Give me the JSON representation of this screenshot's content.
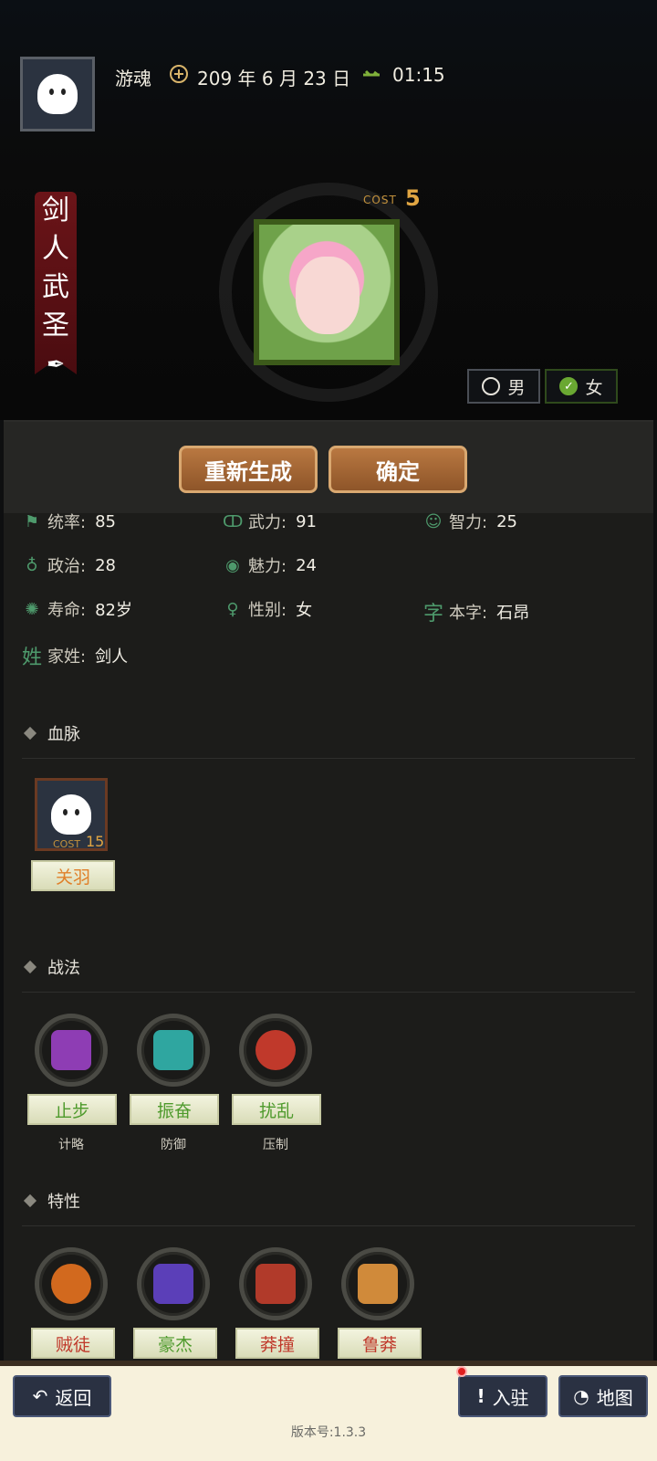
{
  "header": {
    "username": "游魂",
    "date": "209 年 6 月 23 日",
    "time": "01:15"
  },
  "character": {
    "title_chars": [
      "剑",
      "人",
      "武",
      "圣"
    ],
    "cost_label": "COST",
    "cost_value": "5",
    "gender_options": [
      {
        "label": "男",
        "selected": false
      },
      {
        "label": "女",
        "selected": true
      }
    ]
  },
  "actions": {
    "regenerate": "重新生成",
    "confirm": "确定"
  },
  "stats": [
    {
      "icon": "flag-icon",
      "label": "统率:",
      "value": "85"
    },
    {
      "icon": "muscle-icon",
      "label": "武力:",
      "value": "91"
    },
    {
      "icon": "brain-icon",
      "label": "智力:",
      "value": "25"
    },
    {
      "icon": "scroll-icon",
      "label": "政治:",
      "value": "28"
    },
    {
      "icon": "eye-icon",
      "label": "魅力:",
      "value": "24"
    },
    {
      "icon": "lifespan-icon",
      "label": "寿命:",
      "value": "82岁"
    },
    {
      "icon": "gender-icon",
      "label": "性别:",
      "value": "女"
    },
    {
      "icon": "zi-icon",
      "label": "本字:",
      "value": "石昂"
    },
    {
      "icon": "xing-icon",
      "label": "家姓:",
      "value": "剑人"
    }
  ],
  "icon_glyphs": {
    "zi": "字",
    "xing": "姓"
  },
  "sections": {
    "bloodline": "血脉",
    "tactics": "战法",
    "traits": "特性"
  },
  "bloodline": {
    "name": "关羽",
    "cost_label": "COST",
    "cost_value": "15"
  },
  "tactics": [
    {
      "name": "止步",
      "type": "计略",
      "color": "#8e3db4"
    },
    {
      "name": "振奋",
      "type": "防御",
      "color": "#2fa6a0"
    },
    {
      "name": "扰乱",
      "type": "压制",
      "color": "#c0392b"
    }
  ],
  "traits": [
    {
      "name": "贼徒",
      "color": "#d2691e",
      "text_color": "#c0392b"
    },
    {
      "name": "豪杰",
      "color": "#5b3fb8",
      "text_color": "#4e9a2c"
    },
    {
      "name": "莽撞",
      "color": "#b13a2a",
      "text_color": "#c0392b"
    },
    {
      "name": "鲁莽",
      "color": "#d08a3a",
      "text_color": "#c0392b"
    }
  ],
  "bottom": {
    "back": "返回",
    "station": "入驻",
    "map": "地图",
    "version": "版本号:1.3.3"
  }
}
